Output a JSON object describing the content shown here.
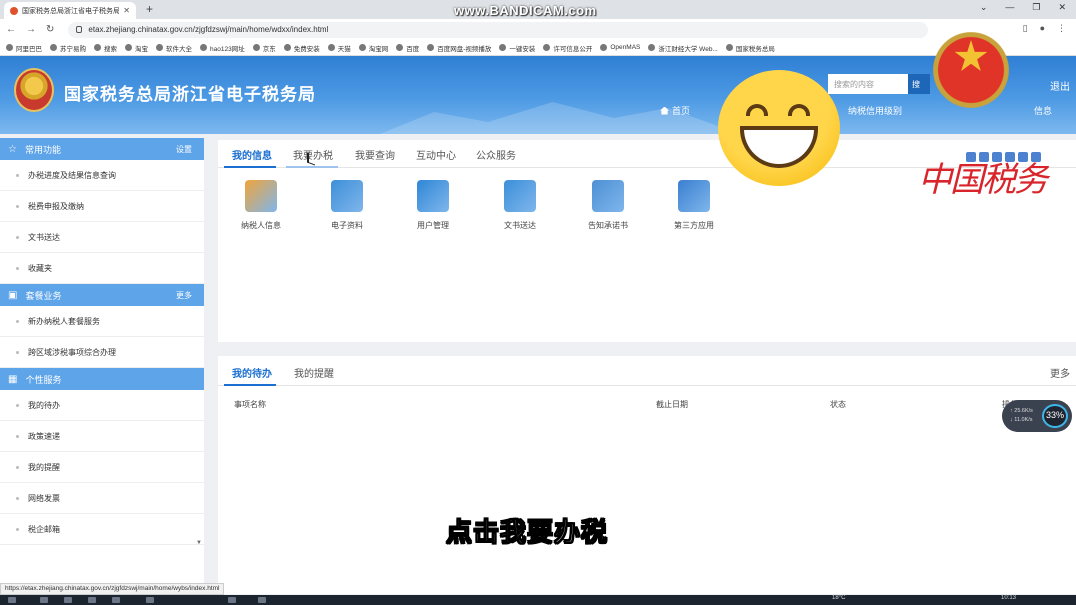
{
  "browser": {
    "tab_title": "国家税务总局浙江省电子税务局",
    "url": "etax.zhejiang.chinatax.gov.cn/zjgfdzswj/main/home/wdxx/index.html",
    "status_url": "https://etax.zhejiang.chinatax.gov.cn/zjgfdzswj/main/home/wybs/index.html",
    "watermark": "www.BANDICAM.com",
    "bookmarks": [
      "阿里巴巴",
      "苏宁易购",
      "搜索",
      "淘宝",
      "软件大全",
      "hao123网址",
      "京东",
      "免费安装",
      "天猫",
      "淘宝网",
      "百度",
      "百度网盘-视频播放",
      "一键安装",
      "许可信息公开",
      "OpenMAS",
      "浙江财经大学 Web...",
      "国家税务总局"
    ]
  },
  "header": {
    "site_title": "国家税务总局浙江省电子税务局",
    "search_placeholder": "搜索的内容",
    "search_button": "搜",
    "logout": "退出",
    "home": "首页",
    "credit": "纳税信用级别",
    "info": "信息"
  },
  "sidebar": {
    "sections": [
      {
        "title": "常用功能",
        "link": "设置",
        "items": [
          "办税进度及结果信息查询",
          "税费申报及缴纳",
          "文书送达",
          "收藏夹"
        ]
      },
      {
        "title": "套餐业务",
        "link": "更多",
        "items": [
          "新办纳税人套餐服务",
          "跨区域涉税事项综合办理"
        ]
      },
      {
        "title": "个性服务",
        "link": "",
        "items": [
          "我的待办",
          "政策速递",
          "我的提醒",
          "网络发票",
          "税企邮箱"
        ]
      }
    ]
  },
  "top_panel": {
    "tabs": [
      "我的信息",
      "我要办税",
      "我要查询",
      "互动中心",
      "公众服务"
    ],
    "apps": [
      {
        "label": "纳税人信息",
        "icon": "taxpayer-info-icon",
        "color": "#f0a43a"
      },
      {
        "label": "电子资料",
        "icon": "printer-icon",
        "color": "#3d8fd8"
      },
      {
        "label": "用户管理",
        "icon": "user-manage-icon",
        "color": "#2f86d6"
      },
      {
        "label": "文书送达",
        "icon": "document-send-icon",
        "color": "#3b8fd9"
      },
      {
        "label": "告知承诺书",
        "icon": "pledge-icon",
        "color": "#4d90d4"
      },
      {
        "label": "第三方应用",
        "icon": "third-party-icon",
        "color": "#3a7fd0"
      }
    ]
  },
  "bottom_panel": {
    "tabs": [
      "我的待办",
      "我的提醒"
    ],
    "more": "更多",
    "columns": [
      "事项名称",
      "截止日期",
      "状态",
      "操作"
    ]
  },
  "overlay": {
    "subtitle": "点击我要办税",
    "badge_text": "中国税务",
    "speed_up": "↑ 25.6K/s",
    "speed_down": "↓ 11.0K/s",
    "speed_pct": "33%",
    "clock": "10:13",
    "weather": "18°C"
  }
}
